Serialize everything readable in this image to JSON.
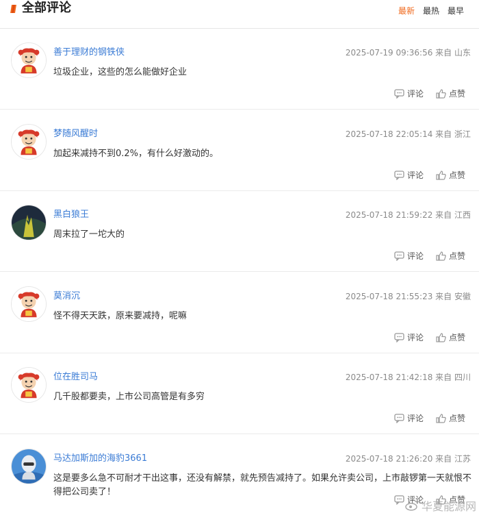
{
  "header": {
    "title": "全部评论",
    "sort": [
      "最新",
      "最热",
      "最早"
    ],
    "active_sort": "最新"
  },
  "actions": {
    "comment": "评论",
    "like": "点赞"
  },
  "comments": [
    {
      "user": "善于理财的钢铁侠",
      "time": "2025-07-19 09:36:56",
      "location": "来自 山东",
      "text": "垃圾企业，这些的怎么能做好企业",
      "avatar": "cartoon"
    },
    {
      "user": "梦随风醒时",
      "time": "2025-07-18 22:05:14",
      "location": "来自 浙江",
      "text": "加起来减持不到0.2%，有什么好激动的。",
      "avatar": "cartoon"
    },
    {
      "user": "黑白狼王",
      "time": "2025-07-18 21:59:22",
      "location": "来自 江西",
      "text": "周末拉了一坨大的",
      "avatar": "wolf"
    },
    {
      "user": "莫消沉",
      "time": "2025-07-18 21:55:23",
      "location": "来自 安徽",
      "text": "怪不得天天跌，原来要减持，呢嘛",
      "avatar": "cartoon"
    },
    {
      "user": "位在胜司马",
      "time": "2025-07-18 21:42:18",
      "location": "来自 四川",
      "text": "几千股都要卖，上市公司高管是有多穷",
      "avatar": "cartoon"
    },
    {
      "user": "马达加斯加的海豹3661",
      "time": "2025-07-18 21:26:20",
      "location": "来自 江苏",
      "text": "这是要多么急不可耐才干出这事，还没有解禁，就先预告减持了。如果允许卖公司，上市敲锣第一天就恨不得把公司卖了！",
      "avatar": "robot"
    }
  ],
  "watermark": "华夏能源网",
  "colors": {
    "accent": "#f06a1e",
    "username": "#3a7bd5"
  }
}
